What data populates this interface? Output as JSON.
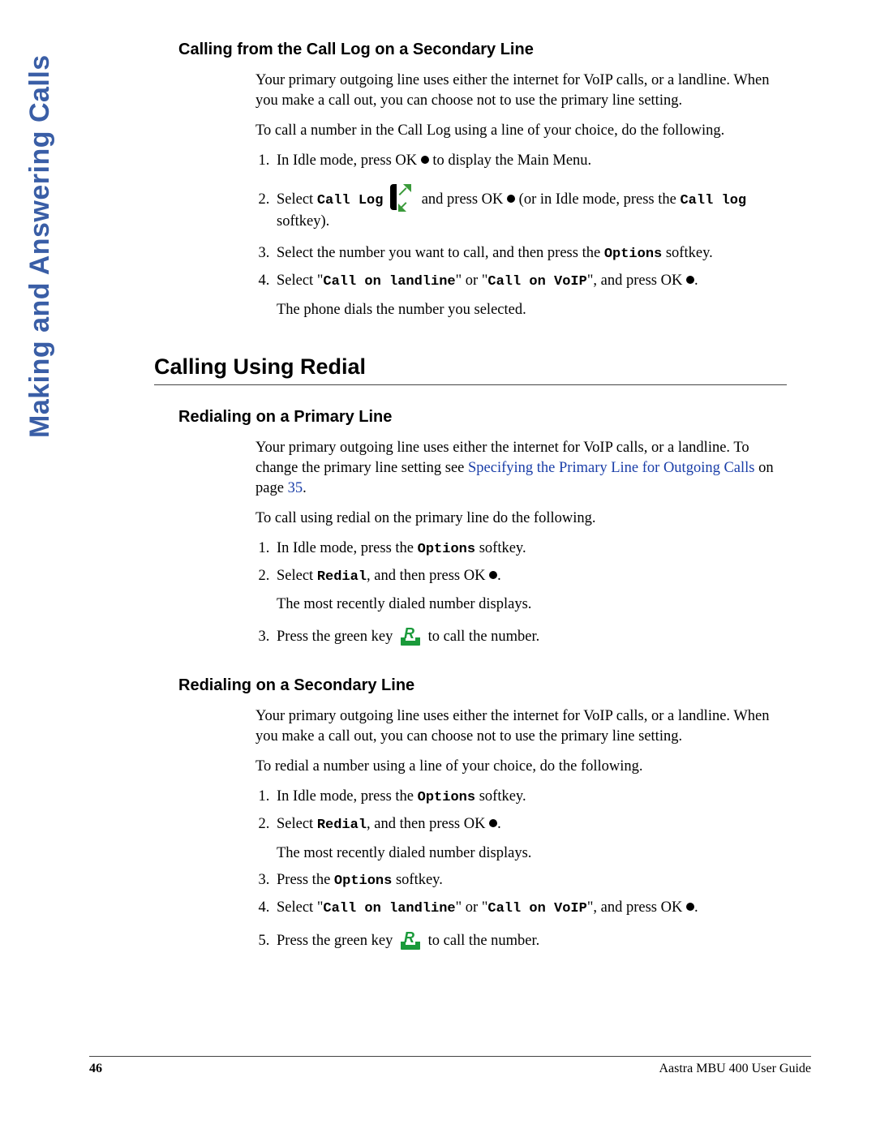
{
  "side_title": "Making and Answering Calls",
  "page_number": "46",
  "footer_guide": "Aastra MBU 400 User Guide",
  "link_text": "Specifying the Primary Line for Outgoing Calls",
  "link_page": "35",
  "ui": {
    "call_log": "Call Log",
    "call_log_sk": "Call log",
    "options": "Options",
    "redial": "Redial",
    "call_landline": "Call on landline",
    "call_voip": "Call on VoIP"
  },
  "sec1": {
    "heading": "Calling from the Call Log on a Secondary Line",
    "p1": "Your primary outgoing line uses either the internet for VoIP calls, or a landline. When you make a call out, you can choose not to use the primary line setting.",
    "p2": "To call a number in the Call Log using a line of your choice, do the following.",
    "s1a": "In Idle mode, press OK ",
    "s1b": " to display the Main Menu.",
    "s2a": "Select ",
    "s2b": " and press OK ",
    "s2c": " (or in Idle mode, press the ",
    "s2d": " softkey).",
    "s3a": "Select the number you want to call, and then press the ",
    "s3b": " softkey.",
    "s4a": "Select \"",
    "s4b": "\" or \"",
    "s4c": "\", and press OK ",
    "s4d": ".",
    "s4e": "The phone dials the number you selected."
  },
  "sec2_heading": "Calling Using Redial",
  "sec3": {
    "heading": "Redialing on a Primary Line",
    "p1a": "Your primary outgoing line uses either the internet for VoIP calls, or a landline. To change the primary line setting see ",
    "p1b": " on page ",
    "p1c": ".",
    "p2": "To call using redial on the primary line do the following.",
    "s1a": "In Idle mode, press the ",
    "s1b": " softkey.",
    "s2a": "Select ",
    "s2b": ", and then press OK ",
    "s2c": ".",
    "s2d": "The most recently dialed number displays.",
    "s3a": "Press the green key ",
    "s3b": " to call the number."
  },
  "sec4": {
    "heading": "Redialing on a Secondary Line",
    "p1": "Your primary outgoing line uses either the internet for VoIP calls, or a landline. When you make a call out, you can choose not to use the primary line setting.",
    "p2": "To redial a number using a line of your choice, do the following.",
    "s1a": "In Idle mode, press the ",
    "s1b": " softkey.",
    "s2a": "Select ",
    "s2b": ", and then press OK ",
    "s2c": ".",
    "s2d": "The most recently dialed number displays.",
    "s3a": "Press the ",
    "s3b": " softkey.",
    "s4a": "Select \"",
    "s4b": "\" or \"",
    "s4c": "\", and press OK ",
    "s4d": ".",
    "s5a": "Press the green key ",
    "s5b": " to call the number."
  }
}
